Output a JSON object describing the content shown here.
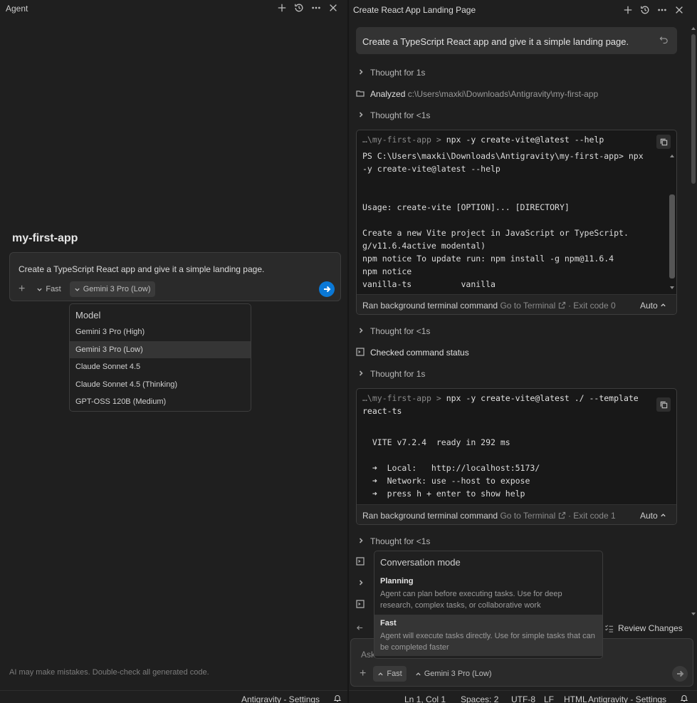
{
  "left_panel": {
    "title": "Agent",
    "project_title": "my-first-app",
    "chat": {
      "prompt": "Create a TypeScript React app and give it a simple landing page.",
      "mode_label": "Fast",
      "model_label": "Gemini 3 Pro (Low)"
    },
    "model_menu": {
      "header": "Model",
      "items": [
        {
          "label": "Gemini 3 Pro (High)"
        },
        {
          "label": "Gemini 3 Pro (Low)"
        },
        {
          "label": "Claude Sonnet 4.5"
        },
        {
          "label": "Claude Sonnet 4.5 (Thinking)"
        },
        {
          "label": "GPT-OSS 120B (Medium)"
        }
      ],
      "selected_index": 1
    },
    "disclaimer": "AI may make mistakes. Double-check all generated code.",
    "status_text": "Antigravity - Settings"
  },
  "right_panel": {
    "title": "Create React App Landing Page",
    "user_message": "Create a TypeScript React app and give it a simple landing page.",
    "steps": {
      "thought_1": "Thought for 1s",
      "analyzed_label": "Analyzed",
      "analyzed_path": "c:\\Users\\maxki\\Downloads\\Antigravity\\my-first-app",
      "thought_2": "Thought for <1s",
      "thought_3": "Thought for <1s",
      "checked": "Checked command status",
      "thought_4": "Thought for 1s",
      "thought_5": "Thought for <1s"
    },
    "terminal_1": {
      "prefix": "…\\my-first-app > ",
      "command": "npx -y create-vite@latest --help",
      "output": [
        "PS C:\\Users\\maxki\\Downloads\\Antigravity\\my-first-app> npx",
        "-y create-vite@latest --help",
        "",
        "",
        "Usage: create-vite [OPTION]... [DIRECTORY]",
        "",
        "Create a new Vite project in JavaScript or TypeScript.",
        "g/v11.6.4active modental)",
        "npm notice To update run: npm install -g npm@11.6.4",
        "npm notice",
        "vanilla-ts          vanilla"
      ],
      "footer_label": "Ran background terminal command",
      "footer_link": "Go to Terminal",
      "footer_exit": "· Exit code 0",
      "auto": "Auto"
    },
    "terminal_2": {
      "prefix": "…\\my-first-app > ",
      "command": "npx -y create-vite@latest ./ --template",
      "command_cont": "react-ts",
      "output": [
        "  VITE v7.2.4  ready in 292 ms",
        "",
        "  ➜  Local:   http://localhost:5173/",
        "  ➜  Network: use --host to expose",
        "  ➜  press h + enter to show help"
      ],
      "footer_label": "Ran background terminal command",
      "footer_link": "Go to Terminal",
      "footer_exit": "· Exit code 1",
      "auto": "Auto"
    },
    "conversation_menu": {
      "header": "Conversation mode",
      "options": [
        {
          "name": "Planning",
          "description": "Agent can plan before executing tasks. Use for deep research, complex tasks, or collaborative work"
        },
        {
          "name": "Fast",
          "description": "Agent will execute tasks directly. Use for simple tasks that can be completed faster"
        }
      ],
      "selected_index": 1
    },
    "review_changes": "Review Changes",
    "input": {
      "placeholder": "Ask",
      "mode_label": "Fast",
      "model_label": "Gemini 3 Pro (Low)"
    },
    "status_bar": {
      "position": "Ln 1, Col 1",
      "spaces": "Spaces: 2",
      "encoding": "UTF-8",
      "eol": "LF",
      "language": "HTML",
      "settings": "Antigravity - Settings"
    }
  },
  "colors": {
    "background": "#1f1f1f",
    "accent": "#0a78d6",
    "panel": "#2a2a2a"
  }
}
